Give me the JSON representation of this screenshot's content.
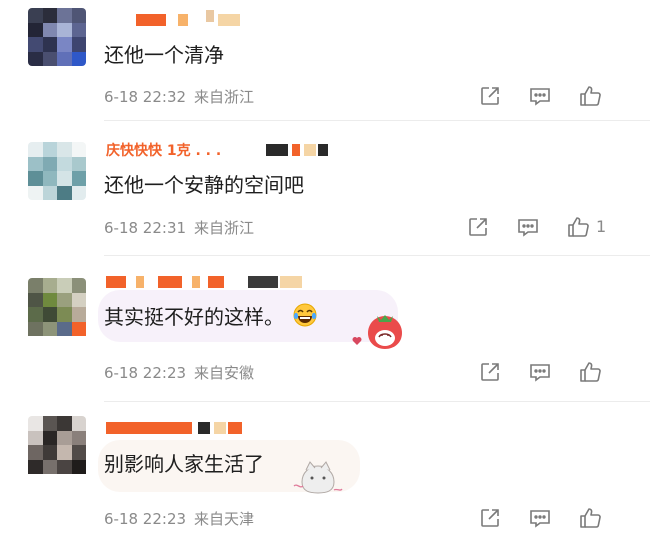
{
  "comments": [
    {
      "text": "还他一个清净",
      "time": "6-18 22:32",
      "location": "来自浙江",
      "likes": ""
    },
    {
      "username": "庆快快快 1克 . . .",
      "text": "还他一个安静的空间吧",
      "time": "6-18 22:31",
      "location": "来自浙江",
      "likes": "1"
    },
    {
      "text": "其实挺不好的这样。",
      "time": "6-18 22:23",
      "location": "来自安徽",
      "likes": ""
    },
    {
      "text": "别影响人家生活了",
      "time": "6-18 22:23",
      "location": "来自天津",
      "likes": ""
    }
  ],
  "icons": {
    "share": "share-icon",
    "comment": "comment-icon",
    "like": "thumbs-up-icon",
    "laugh_emoji": "tears-of-joy-emoji"
  },
  "colors": {
    "text": "#1e1e1e",
    "meta": "#8a8a8a",
    "icon": "#7a7a7a",
    "redacted_orange": "#f2622a"
  }
}
